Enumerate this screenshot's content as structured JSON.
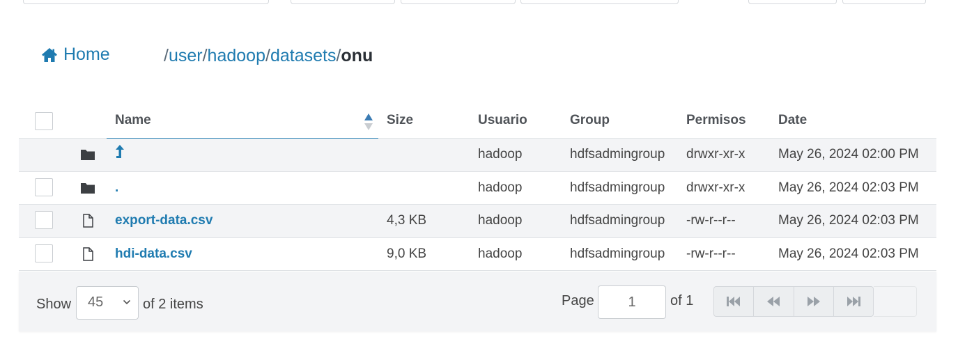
{
  "breadcrumb": {
    "home_label": "Home",
    "path_segments": [
      "user",
      "hadoop",
      "datasets"
    ],
    "current": "onu",
    "separator": "/"
  },
  "table": {
    "headers": {
      "name": "Name",
      "size": "Size",
      "user": "Usuario",
      "group": "Group",
      "perms": "Permisos",
      "date": "Date"
    },
    "sort": {
      "column": "Name",
      "direction": "ascending"
    },
    "rows": [
      {
        "type": "folder",
        "name": "⮥",
        "size": "",
        "user": "hadoop",
        "group": "hdfsadmingroup",
        "perms": "drwxr-xr-x",
        "date": "May 26, 2024 02:00 PM",
        "checkbox": false,
        "icon": "folder-icon"
      },
      {
        "type": "folder",
        "name": ".",
        "size": "",
        "user": "hadoop",
        "group": "hdfsadmingroup",
        "perms": "drwxr-xr-x",
        "date": "May 26, 2024 02:03 PM",
        "checkbox": true,
        "icon": "folder-icon"
      },
      {
        "type": "file",
        "name": "export-data.csv",
        "size": "4,3 KB",
        "user": "hadoop",
        "group": "hdfsadmingroup",
        "perms": "-rw-r--r--",
        "date": "May 26, 2024 02:03 PM",
        "checkbox": true,
        "icon": "file-icon"
      },
      {
        "type": "file",
        "name": "hdi-data.csv",
        "size": "9,0 KB",
        "user": "hadoop",
        "group": "hdfsadmingroup",
        "perms": "-rw-r--r--",
        "date": "May 26, 2024 02:03 PM",
        "checkbox": true,
        "icon": "file-icon"
      }
    ]
  },
  "footer": {
    "show_label": "Show",
    "page_size": "45",
    "items_label": "of 2 items",
    "page_label": "Page",
    "page_value": "1",
    "of_pages_label": "of 1",
    "pager_buttons": [
      "first-page-icon",
      "previous-page-icon",
      "next-page-icon",
      "last-page-icon"
    ]
  },
  "colors": {
    "link": "#1f7bb0",
    "row_alt": "#f3f4f6",
    "border": "#dfe2e5"
  }
}
